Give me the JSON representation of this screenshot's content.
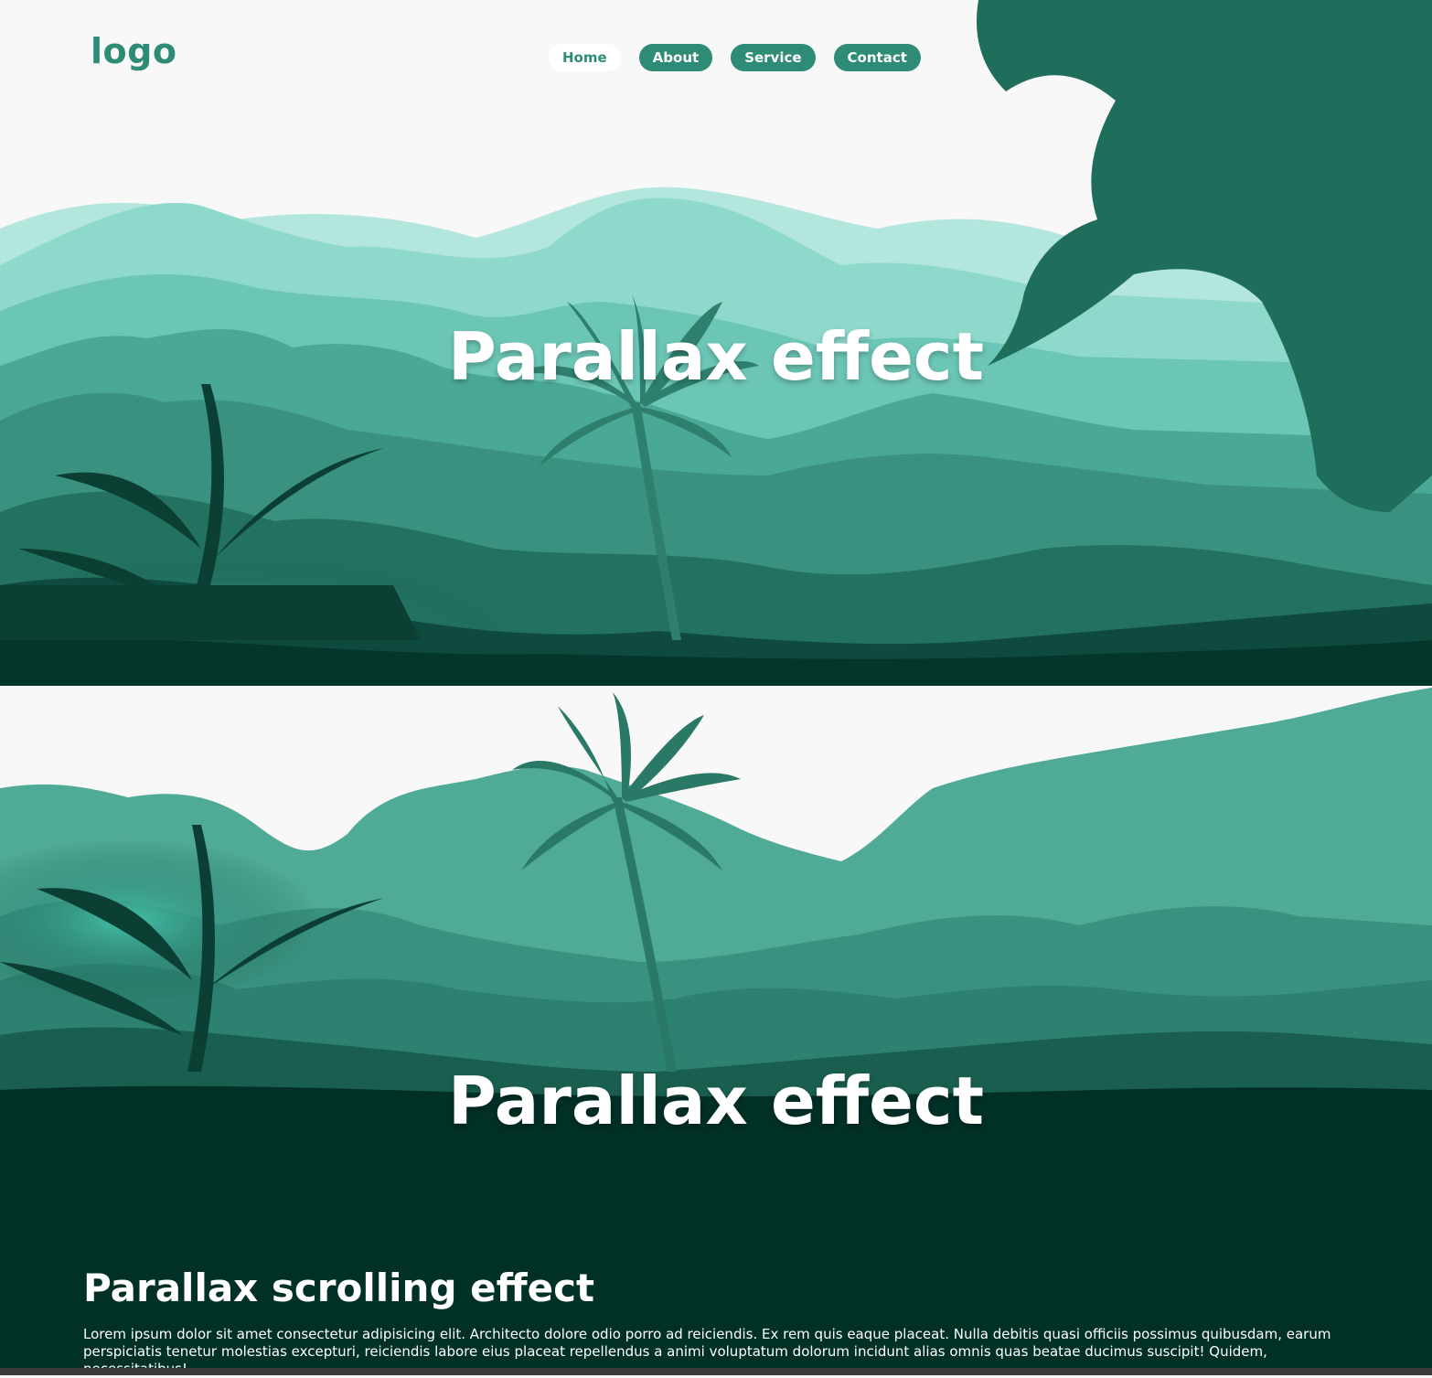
{
  "header": {
    "logo": "logo",
    "nav": [
      {
        "label": "Home",
        "active": true
      },
      {
        "label": "About",
        "active": false
      },
      {
        "label": "Service",
        "active": false
      },
      {
        "label": "Contact",
        "active": false
      }
    ]
  },
  "hero": {
    "title_top": "Parallax effect",
    "title_bottom": "Parallax effect"
  },
  "content": {
    "heading": "Parallax scrolling effect",
    "paragraph": "Lorem ipsum dolor sit amet consectetur adipisicing elit. Architecto dolore odio porro ad reiciendis. Ex rem quis eaque placeat. Nulla debitis quasi officiis possimus quibusdam, earum perspiciatis tenetur molestias excepturi, reiciendis labore eius placeat repellendus a animi voluptatum dolorum incidunt alias omnis quas beatae ducimus suscipit! Quidem, necessitatibus!"
  },
  "colors": {
    "accent": "#2e8b75",
    "background": "#f8f8f8",
    "deep_forest": "#013027",
    "mountain_light": "#a8e3d9"
  },
  "icons": [
    "palm-tree",
    "fern-leaf",
    "mountain-range"
  ]
}
